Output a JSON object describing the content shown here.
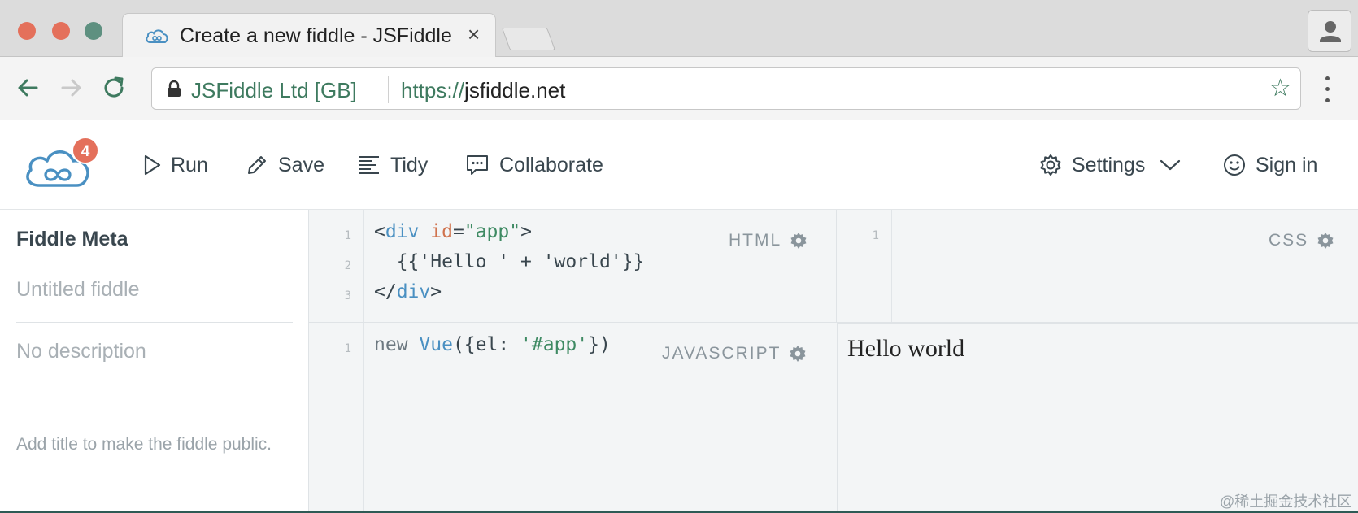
{
  "browser": {
    "tab_title": "Create a new fiddle - JSFiddle",
    "tab_close": "×",
    "site_identity": "JSFiddle Ltd [GB]",
    "url_scheme": "https://",
    "url_host": "jsfiddle.net",
    "star": "☆"
  },
  "app": {
    "notification_count": "4",
    "actions": {
      "run": "Run",
      "save": "Save",
      "tidy": "Tidy",
      "collaborate": "Collaborate",
      "settings": "Settings",
      "sign_in": "Sign in"
    }
  },
  "sidebar": {
    "title": "Fiddle Meta",
    "title_placeholder": "Untitled fiddle",
    "description_placeholder": "No description",
    "hint": "Add title to make the fiddle public."
  },
  "panels": {
    "html": {
      "label": "HTML",
      "line_numbers": [
        "1",
        "2",
        "3"
      ],
      "lines": [
        {
          "lt": "<",
          "tag": "div",
          "sp": " ",
          "attr": "id",
          "eq": "=",
          "val": "\"app\"",
          "gt": ">"
        },
        {
          "text": "  {{'Hello ' + 'world'}}"
        },
        {
          "lt": "</",
          "tag": "div",
          "gt": ">"
        }
      ]
    },
    "css": {
      "label": "CSS",
      "line_numbers": [
        "1"
      ]
    },
    "javascript": {
      "label": "JAVASCRIPT",
      "line_numbers": [
        "1"
      ],
      "line": {
        "kw": "new ",
        "fn": "Vue",
        "open": "({el: ",
        "str": "'#app'",
        "close": "})"
      }
    },
    "result": {
      "text": "Hello world"
    }
  },
  "watermark": "@稀土掘金技术社区",
  "colors": {
    "accent_green": "#3e7a5f",
    "badge_orange": "#e4705b",
    "panel_bg": "#f3f5f6",
    "logo_blue": "#4a90c2"
  },
  "icons": [
    "cloud-infinity-icon",
    "lock-icon",
    "star-icon",
    "play-icon",
    "pencil-icon",
    "tidy-lines-icon",
    "chat-bubble-icon",
    "gear-icon",
    "chevron-down-icon",
    "smiley-icon",
    "user-icon"
  ]
}
